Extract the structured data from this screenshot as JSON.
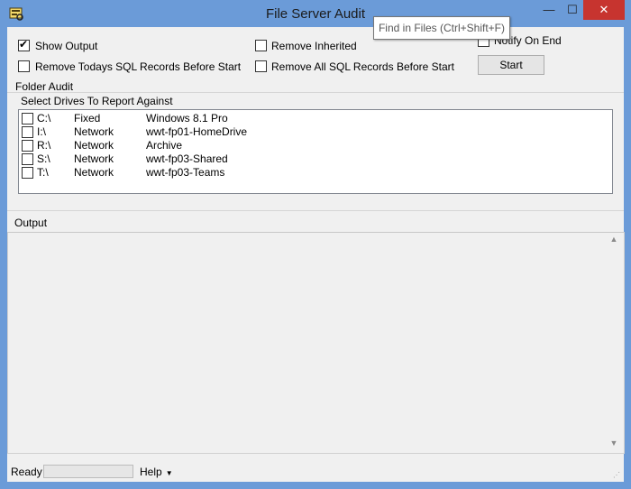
{
  "window": {
    "title": "File Server Audit",
    "controls": {
      "minimize": "—",
      "maximize": "☐",
      "close": "✕"
    }
  },
  "tooltip": "Find in Files (Ctrl+Shift+F)",
  "options": {
    "show_output": {
      "label": "Show Output",
      "checked": true
    },
    "remove_inherited": {
      "label": "Remove Inherited",
      "checked": false
    },
    "notify_on_end": {
      "label": "Notify On End",
      "checked": false
    },
    "remove_todays_sql": {
      "label": "Remove Todays SQL Records Before Start",
      "checked": false
    },
    "remove_all_sql": {
      "label": "Remove All SQL Records Before Start",
      "checked": false
    }
  },
  "start_button": "Start",
  "folder_audit": {
    "group_label": "Folder Audit",
    "instructions": "Select Drives To Report Against",
    "drives": [
      {
        "letter": "C:\\",
        "type": "Fixed",
        "name": "Windows 8.1 Pro",
        "checked": false
      },
      {
        "letter": "I:\\",
        "type": "Network",
        "name": "wwt-fp01-HomeDrive",
        "checked": false
      },
      {
        "letter": "R:\\",
        "type": "Network",
        "name": "Archive",
        "checked": false
      },
      {
        "letter": "S:\\",
        "type": "Network",
        "name": "wwt-fp03-Shared",
        "checked": false
      },
      {
        "letter": "T:\\",
        "type": "Network",
        "name": "wwt-fp03-Teams",
        "checked": false
      }
    ]
  },
  "output": {
    "label": "Output",
    "text": ""
  },
  "status": {
    "text": "Ready",
    "help": "Help",
    "progress": 0
  },
  "colors": {
    "titlebar": "#6b9bd8",
    "close": "#c7342f",
    "client": "#f0f0f0"
  }
}
